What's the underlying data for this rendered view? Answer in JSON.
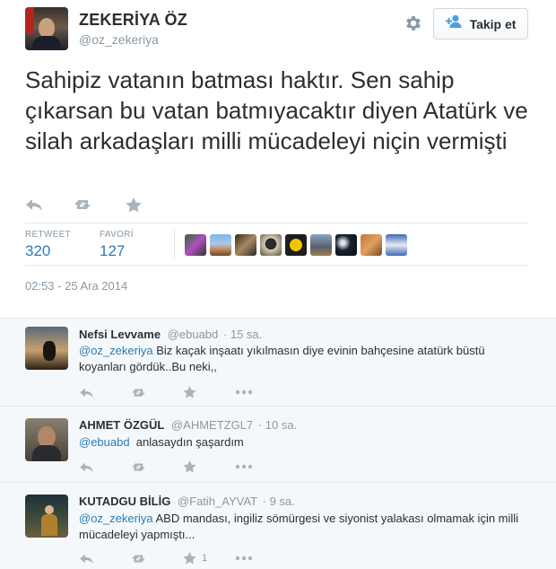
{
  "profile": {
    "name": "ZEKERİYA ÖZ",
    "handle": "@oz_zekeriya",
    "follow_label": "Takip et"
  },
  "tweet": {
    "text": "Sahipiz vatanın batması haktır. Sen sahip çıkarsan bu vatan batmıyacaktır diyen Atatürk ve silah arkadaşları milli mücadeleyi niçin vermişti",
    "retweet_label": "RETWEET",
    "retweet_count": "320",
    "favorite_label": "FAVORİ",
    "favorite_count": "127",
    "timestamp": "02:53 - 25 Ara 2014"
  },
  "icons": {
    "reply": "reply-icon",
    "retweet": "retweet-icon",
    "favorite": "star-icon",
    "more": "more-icon",
    "settings": "gear-icon",
    "follow": "add-person-icon"
  },
  "colors": {
    "link": "#2b7bb9",
    "muted": "#8899a6",
    "icon": "#a8b4bd",
    "text": "#292f33",
    "reply_bg": "#f5f8fa"
  },
  "replies": [
    {
      "name": "Nefsi Levvame",
      "handle": "@ebuabd",
      "time": "15 sa.",
      "mention": "@oz_zekeriya",
      "text": " Biz kaçak inşaatı yıkılmasın diye evinin bahçesine atatürk büstü koyanları gördük..Bu neki,,",
      "favorite_count": ""
    },
    {
      "name": "AHMET ÖZGÜL",
      "handle": "@AHMETZGL7",
      "time": "10 sa.",
      "mention": "@ebuabd",
      "text": "  anlasaydın şaşardım",
      "favorite_count": ""
    },
    {
      "name": "KUTADGU BİLİG",
      "handle": "@Fatih_AYVAT",
      "time": "9 sa.",
      "mention": "@oz_zekeriya",
      "text": " ABD mandası, ingiliz sömürgesi ve siyonist yalakası olmamak için milli mücadeleyi yapmıştı...",
      "favorite_count": "1"
    }
  ]
}
